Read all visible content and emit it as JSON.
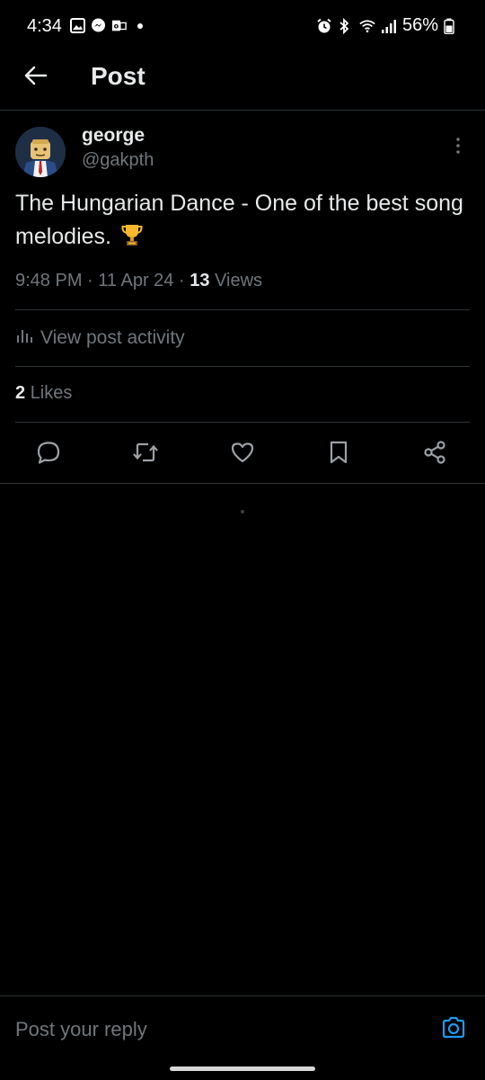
{
  "status_bar": {
    "time": "4:34",
    "battery": "56%",
    "left_icons": [
      "gallery-icon",
      "messenger-icon",
      "outlook-icon"
    ],
    "right_icons": [
      "alarm-icon",
      "bluetooth-icon",
      "wifi-icon",
      "signal-icon",
      "battery-icon"
    ]
  },
  "header": {
    "title": "Post",
    "back_icon": "arrow-left-icon"
  },
  "post": {
    "display_name": "george",
    "handle": "@gakpth",
    "text": "The Hungarian Dance - One of the best song melodies.",
    "emoji_icon": "trophy-icon",
    "time": "9:48 PM",
    "date": "11 Apr 24",
    "views_count": "13",
    "views_label": "Views",
    "separator": "·"
  },
  "activity": {
    "label": "View post activity",
    "icon": "analytics-icon"
  },
  "likes": {
    "count": "2",
    "label": "Likes"
  },
  "actions": [
    "reply-icon",
    "repost-icon",
    "like-icon",
    "bookmark-icon",
    "share-icon"
  ],
  "reply": {
    "placeholder": "Post your reply",
    "camera_icon": "camera-icon"
  },
  "colors": {
    "background": "#000000",
    "primary_text": "#e7e9ea",
    "secondary_text": "#71767b",
    "divider": "#2f3336",
    "accent": "#1d9bf0"
  }
}
